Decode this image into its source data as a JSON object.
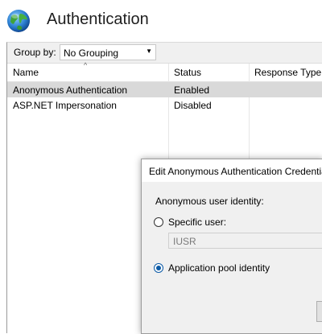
{
  "header": {
    "title": "Authentication",
    "icon": "globe-icon"
  },
  "toolbar": {
    "group_by_label": "Group by:",
    "group_by_value": "No Grouping"
  },
  "table": {
    "columns": [
      "Name",
      "Status",
      "Response Type"
    ],
    "rows": [
      {
        "name": "Anonymous Authentication",
        "status": "Enabled",
        "response_type": ""
      },
      {
        "name": "ASP.NET Impersonation",
        "status": "Disabled",
        "response_type": ""
      }
    ]
  },
  "dialog": {
    "title": "Edit Anonymous Authentication Credentials",
    "identity_label": "Anonymous user identity:",
    "specific_user_label": "Specific user:",
    "specific_user_value": "IUSR",
    "app_pool_label": "Application pool identity",
    "selected": "Application pool identity"
  }
}
